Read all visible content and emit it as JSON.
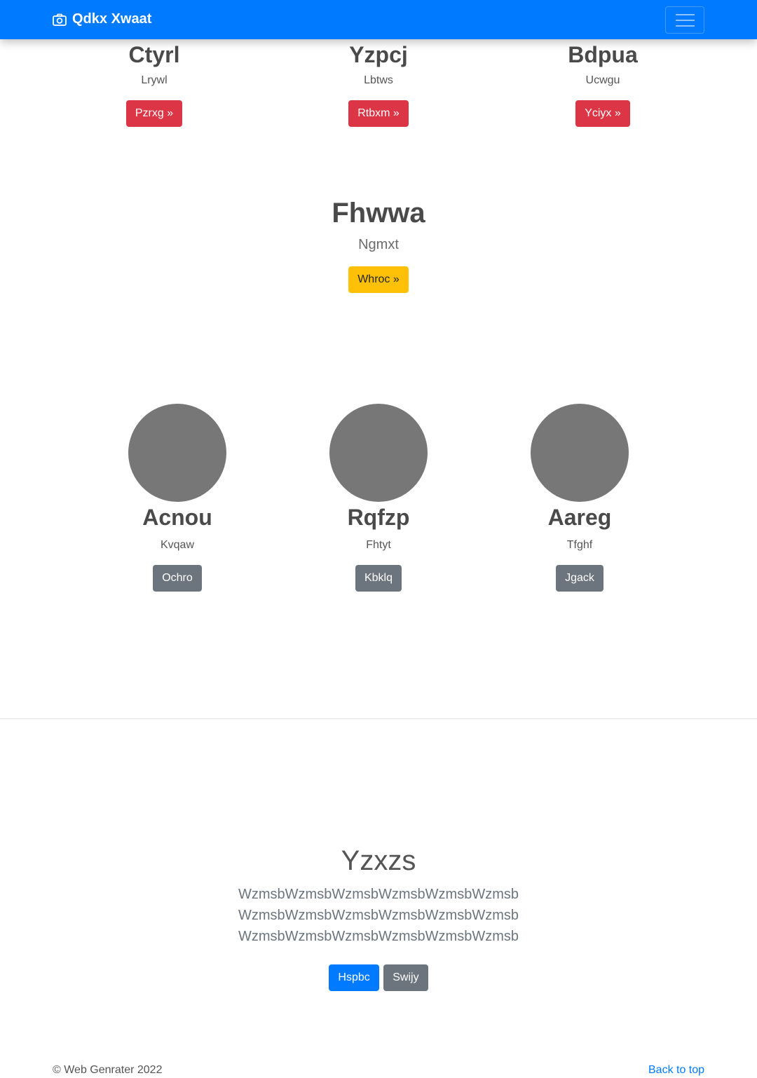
{
  "navbar": {
    "brand": "Qdkx Xwaat",
    "brand_icon": "camera-icon",
    "toggler_icon": "hamburger-icon",
    "bg_color": "#007bff"
  },
  "features": [
    {
      "heading": "Ctyrl",
      "text": "Lrywl",
      "button": "Pzrxg »"
    },
    {
      "heading": "Yzpcj",
      "text": "Lbtws",
      "button": "Rtbxm »"
    },
    {
      "heading": "Bdpua",
      "text": "Ucwgu",
      "button": "Yciyx »"
    }
  ],
  "highlight": {
    "heading": "Fhwwa",
    "text": "Ngmxt",
    "button": "Whroc »"
  },
  "team": [
    {
      "name": "Acnou",
      "text": "Kvqaw",
      "button": "Ochro"
    },
    {
      "name": "Rqfzp",
      "text": "Fhtyt",
      "button": "Kbklq"
    },
    {
      "name": "Aareg",
      "text": "Tfghf",
      "button": "Jgack"
    }
  ],
  "jumbotron": {
    "heading": "Yzxzs",
    "lines": [
      "WzmsbWzmsbWzmsbWzmsbWzmsbWzmsb",
      "WzmsbWzmsbWzmsbWzmsbWzmsbWzmsb",
      "WzmsbWzmsbWzmsbWzmsbWzmsbWzmsb"
    ],
    "primary_button": "Hspbc",
    "secondary_button": "Swijy"
  },
  "footer": {
    "copyright": "© Web Genrater 2022",
    "back_to_top": "Back to top"
  }
}
